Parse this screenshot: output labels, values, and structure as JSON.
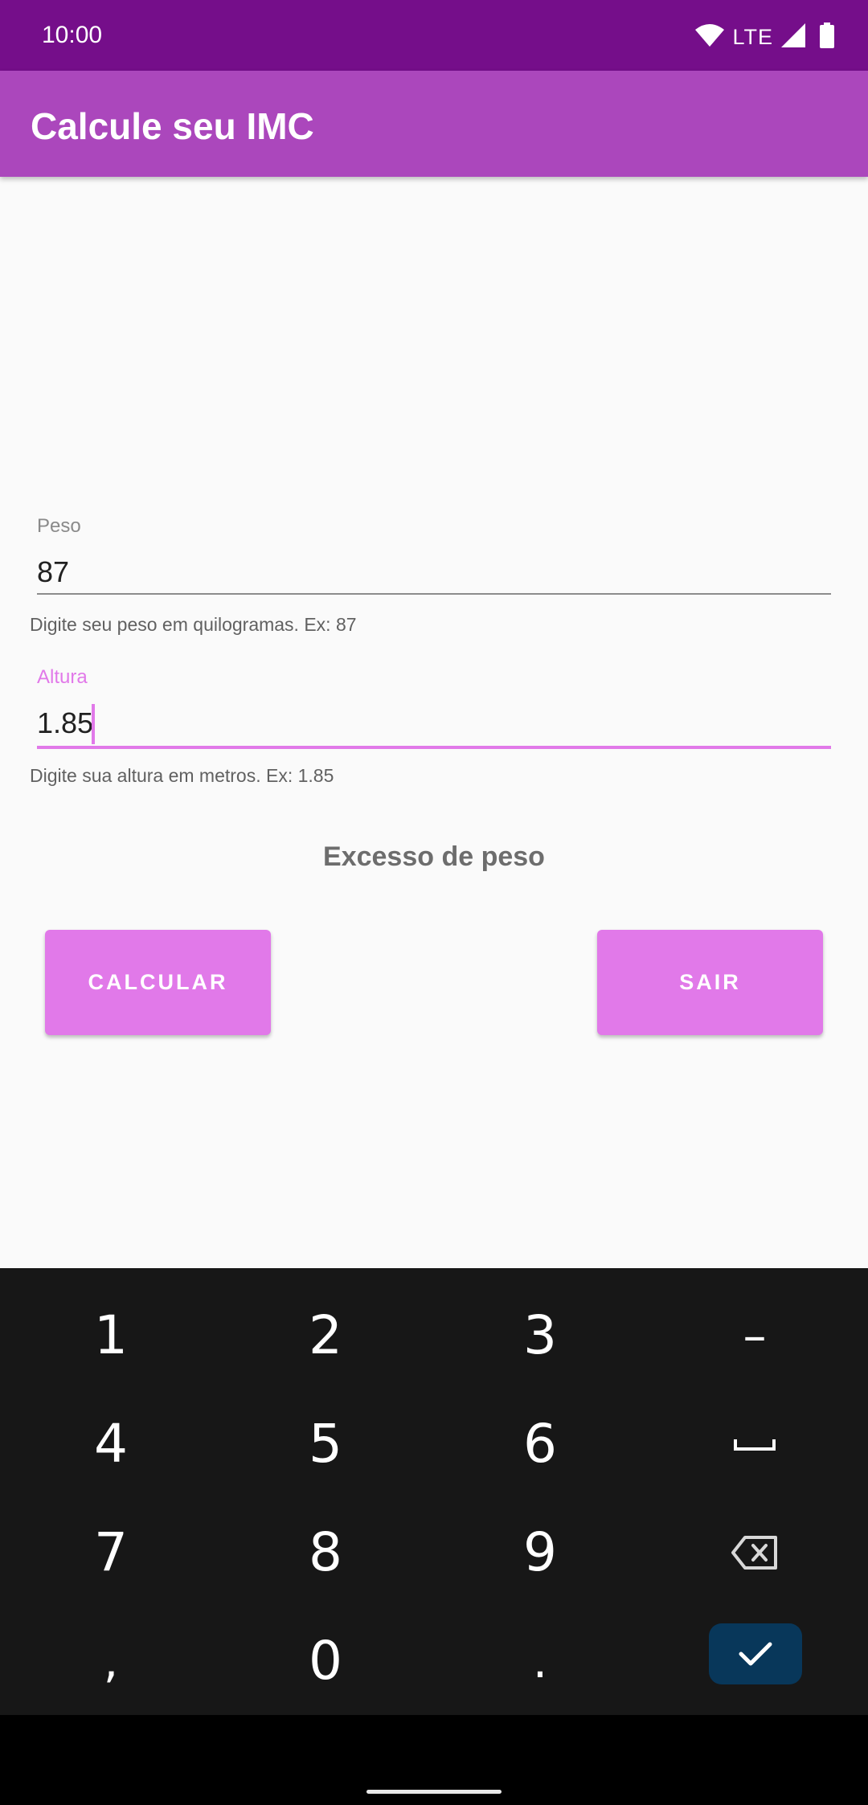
{
  "status_bar": {
    "time": "10:00",
    "network": "LTE"
  },
  "app_bar": {
    "title": "Calcule seu IMC"
  },
  "form": {
    "peso": {
      "label": "Peso",
      "value": "87",
      "helper": "Digite seu peso em quilogramas. Ex: 87"
    },
    "altura": {
      "label": "Altura",
      "value": "1.85",
      "helper": "Digite sua altura em metros. Ex: 1.85"
    }
  },
  "result": {
    "text": "Excesso de peso"
  },
  "buttons": {
    "calcular": "CALCULAR",
    "sair": "SAIR"
  },
  "keyboard": {
    "keys": [
      "1",
      "2",
      "3",
      "–",
      "4",
      "5",
      "6",
      "␣",
      "7",
      "8",
      "9",
      "⌫",
      ",",
      "0",
      ".",
      "✓"
    ]
  },
  "colors": {
    "status_bar": "#750e8a",
    "app_bar": "#ab47bc",
    "accent": "#e179e9",
    "keyboard_bg": "#171717",
    "done_key": "#08375a"
  }
}
